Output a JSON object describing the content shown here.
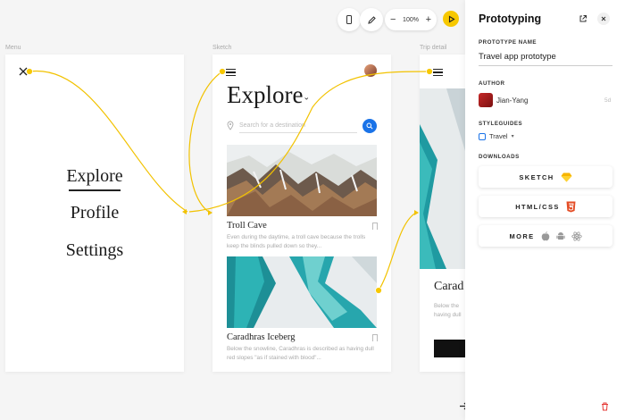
{
  "toolbar": {
    "zoom_level": "100%",
    "zoom_minus": "−",
    "zoom_plus": "+"
  },
  "frames": {
    "menu": {
      "label": "Menu",
      "items": [
        "Explore",
        "Profile",
        "Settings"
      ]
    },
    "sketch": {
      "label": "Sketch",
      "title": "Explore",
      "search_placeholder": "Search for a destination",
      "cards": [
        {
          "title": "Troll Cave",
          "desc": "Even during the daytime, a troll cave because the trolls keep the blinds pulled down so they..."
        },
        {
          "title": "Caradhras Iceberg",
          "desc": "Below the snowline, Caradhras is described as having dull red slopes \"as if stained with blood\"..."
        }
      ]
    },
    "trip_detail": {
      "label": "Trip detail",
      "title": "Carad",
      "desc": "Below the having dull"
    }
  },
  "panel": {
    "title": "Prototyping",
    "name_label": "PROTOTYPE NAME",
    "name_value": "Travel app prototype",
    "author_label": "AUTHOR",
    "author_name": "Jian-Yang",
    "author_time": "5d",
    "styleguides_label": "STYLEGUIDES",
    "styleguide_value": "Travel",
    "downloads_label": "DOWNLOADS",
    "downloads": {
      "sketch": "SKETCH",
      "html": "HTML/CSS",
      "more": "MORE"
    }
  },
  "colors": {
    "accent": "#f7c800",
    "link": "#f2c200",
    "search": "#1a73e8",
    "teal": "#1fa3a8"
  }
}
